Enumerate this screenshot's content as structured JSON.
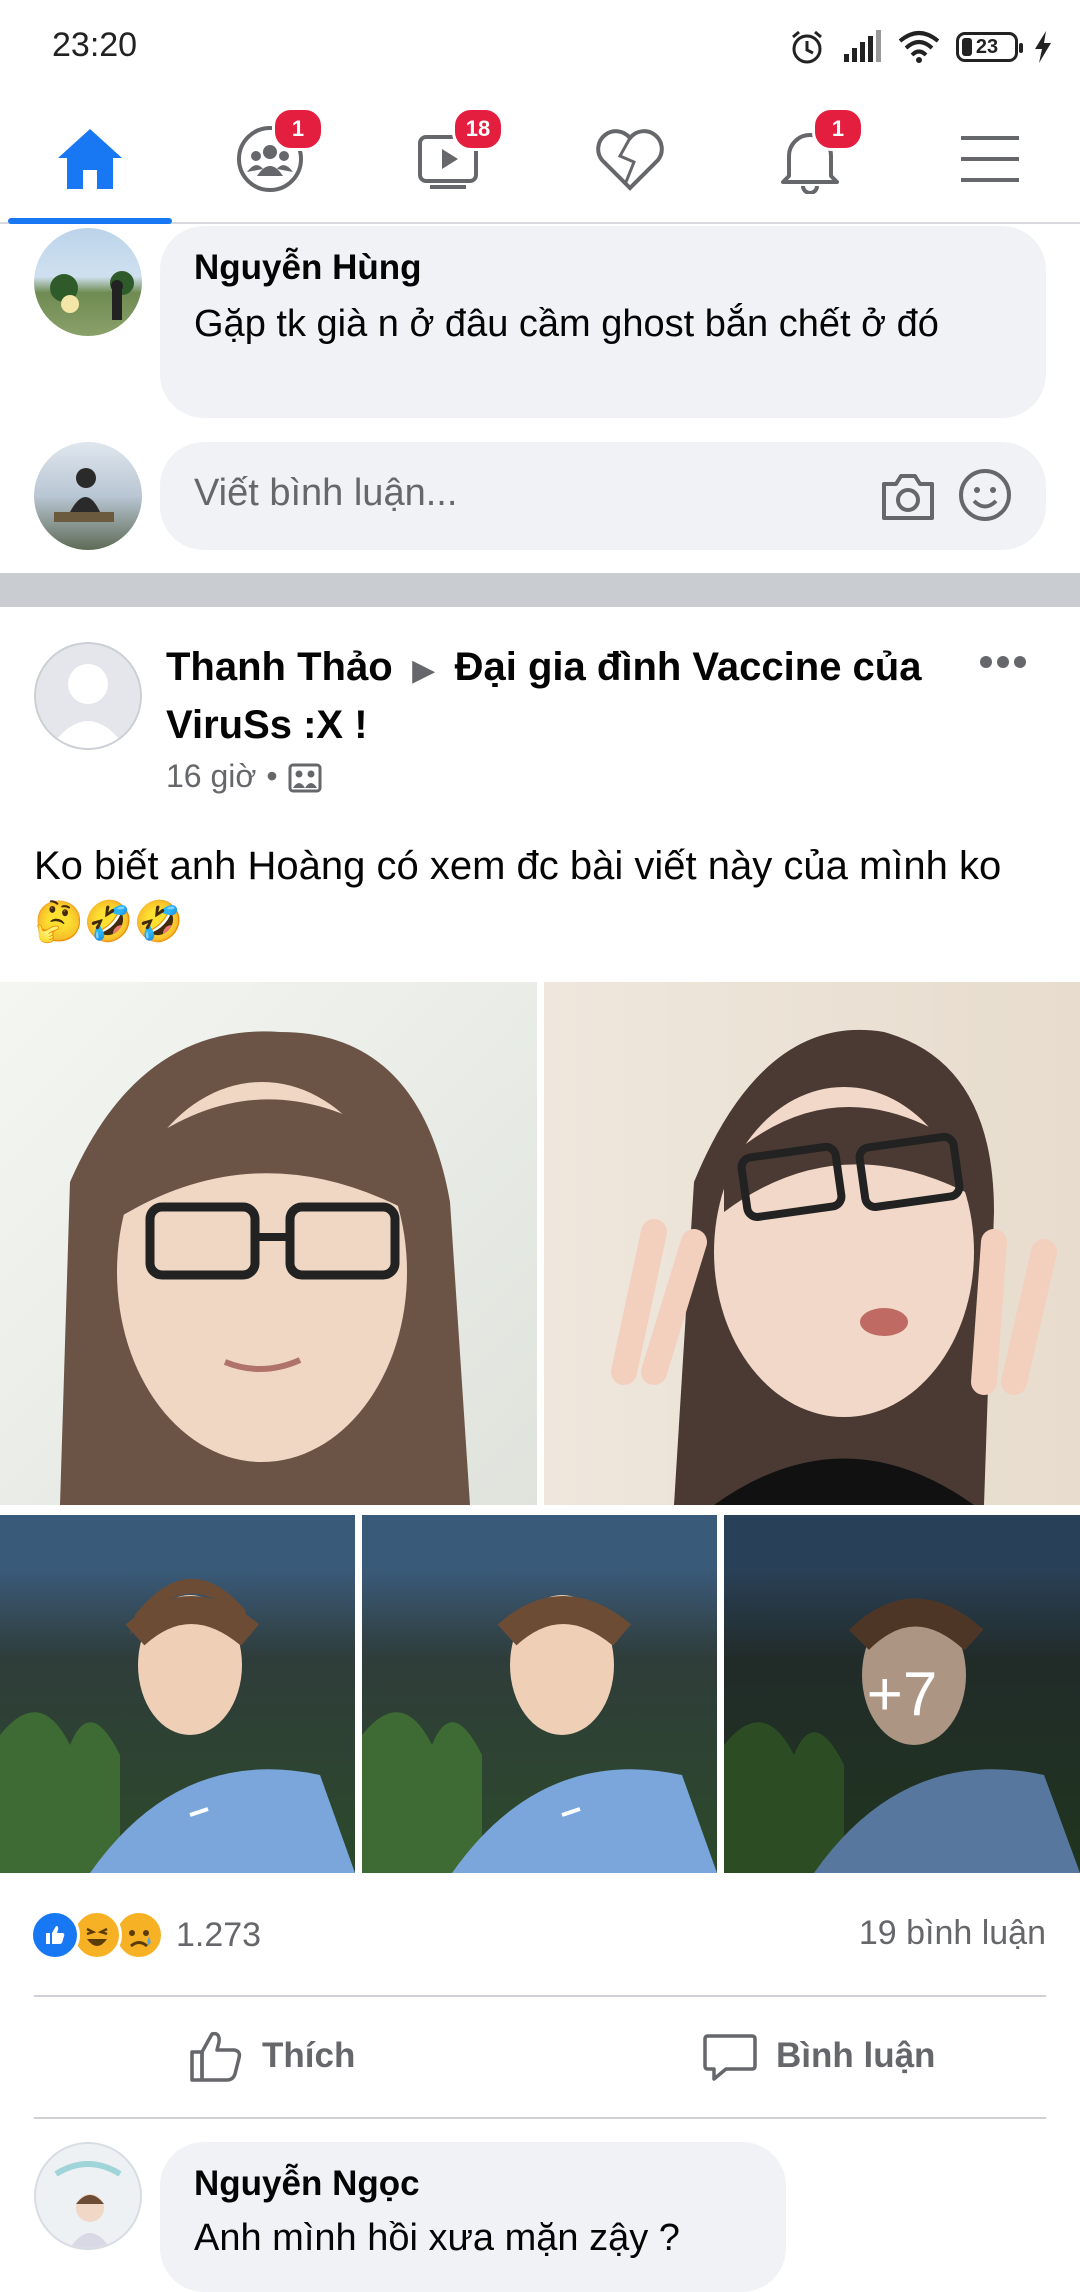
{
  "status_bar": {
    "time": "23:20",
    "battery": "23"
  },
  "nav": {
    "tabs": [
      {
        "name": "home",
        "badge": ""
      },
      {
        "name": "groups",
        "badge": "1"
      },
      {
        "name": "watch",
        "badge": "18"
      },
      {
        "name": "dating",
        "badge": ""
      },
      {
        "name": "notifications",
        "badge": "1"
      },
      {
        "name": "menu",
        "badge": ""
      }
    ],
    "active_color": "#1877f2"
  },
  "top_comment": {
    "author": "Nguyễn Hùng",
    "text": "Gặp tk già n ở đâu cầm ghost bắn chết ở đó"
  },
  "comment_input": {
    "placeholder": "Viết bình luận..."
  },
  "post": {
    "author": "Thanh Thảo",
    "group": "Đại gia đình Vaccine của ViruSs :X !",
    "time": "16 giờ",
    "separator": "•",
    "text": "Ko biết anh Hoàng có xem đc bài viết này của mình ko 🤔🤣🤣",
    "more_photos": "+7",
    "reactions_count": "1.273",
    "comments_count": "19 bình luận",
    "like_label": "Thích",
    "comment_label": "Bình luận"
  },
  "bottom_comment": {
    "author": "Nguyễn Ngọc",
    "text": "Anh mình hồi xưa mặn zậy ?"
  }
}
